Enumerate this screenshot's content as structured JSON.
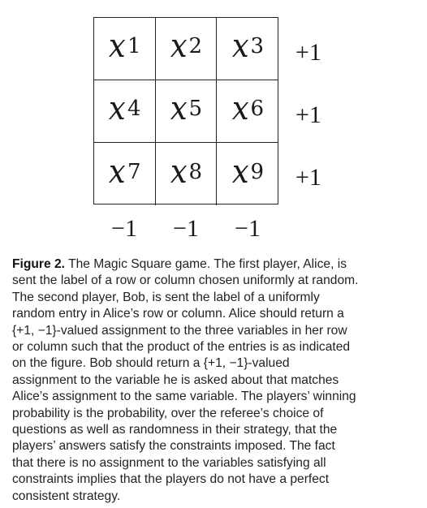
{
  "figure": {
    "cells": [
      {
        "var": "x",
        "sub": "1"
      },
      {
        "var": "x",
        "sub": "2"
      },
      {
        "var": "x",
        "sub": "3"
      },
      {
        "var": "x",
        "sub": "4"
      },
      {
        "var": "x",
        "sub": "5"
      },
      {
        "var": "x",
        "sub": "6"
      },
      {
        "var": "x",
        "sub": "7"
      },
      {
        "var": "x",
        "sub": "8"
      },
      {
        "var": "x",
        "sub": "9"
      }
    ],
    "row_labels": [
      "+1",
      "+1",
      "+1"
    ],
    "col_labels": [
      "−1",
      "−1",
      "−1"
    ]
  },
  "caption": {
    "label": "Figure 2.",
    "text": "The Magic Square game. The first player, Alice, is\nsent the label of a row or column chosen uniformly at random.\nThe second player, Bob, is sent the label of a uniformly\nrandom entry in Alice’s row or column. Alice should return a\n{+1, −1}-valued assignment to the three variables in her row\nor column such that the product of the entries is as indicated\non the figure. Bob should return a {+1, −1}-valued\nassignment to the variable he is asked about that matches\nAlice’s assignment to the same variable. The players’ winning\nprobability is the probability, over the referee’s choice of\nquestions as well as randomness in their strategy, that the\nplayers’ answers satisfy the constraints imposed. The fact\nthat there is no assignment to the variables satisfying all\nconstraints implies that the players do not have a perfect\nconsistent strategy."
  }
}
